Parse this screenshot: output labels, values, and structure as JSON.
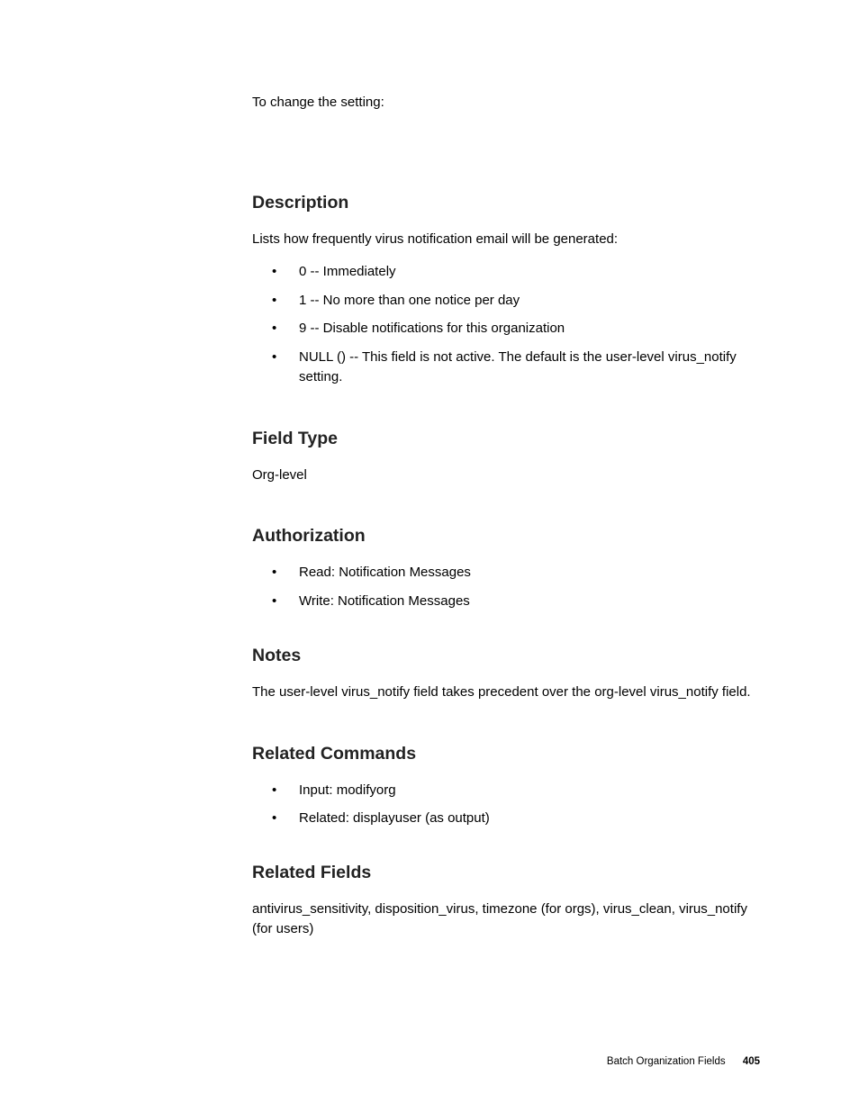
{
  "intro": "To change the setting:",
  "sections": {
    "description": {
      "heading": "Description",
      "lead": "Lists how frequently virus notification email will be generated:",
      "items": [
        "0 -- Immediately",
        "1 -- No more than one notice per day",
        "9 -- Disable notifications for this organization",
        "NULL () -- This field is not active. The default is the user-level virus_notify setting."
      ]
    },
    "field_type": {
      "heading": "Field Type",
      "body": "Org-level"
    },
    "authorization": {
      "heading": "Authorization",
      "items": [
        "Read: Notification Messages",
        "Write: Notification Messages"
      ]
    },
    "notes": {
      "heading": "Notes",
      "body": "The user-level virus_notify field takes precedent over the org-level virus_notify field."
    },
    "related_commands": {
      "heading": "Related Commands",
      "items": [
        "Input: modifyorg",
        "Related: displayuser (as output)"
      ]
    },
    "related_fields": {
      "heading": "Related Fields",
      "body": "antivirus_sensitivity, disposition_virus, timezone (for orgs), virus_clean, virus_notify (for users)"
    }
  },
  "footer": {
    "title": "Batch Organization Fields",
    "page": "405"
  }
}
